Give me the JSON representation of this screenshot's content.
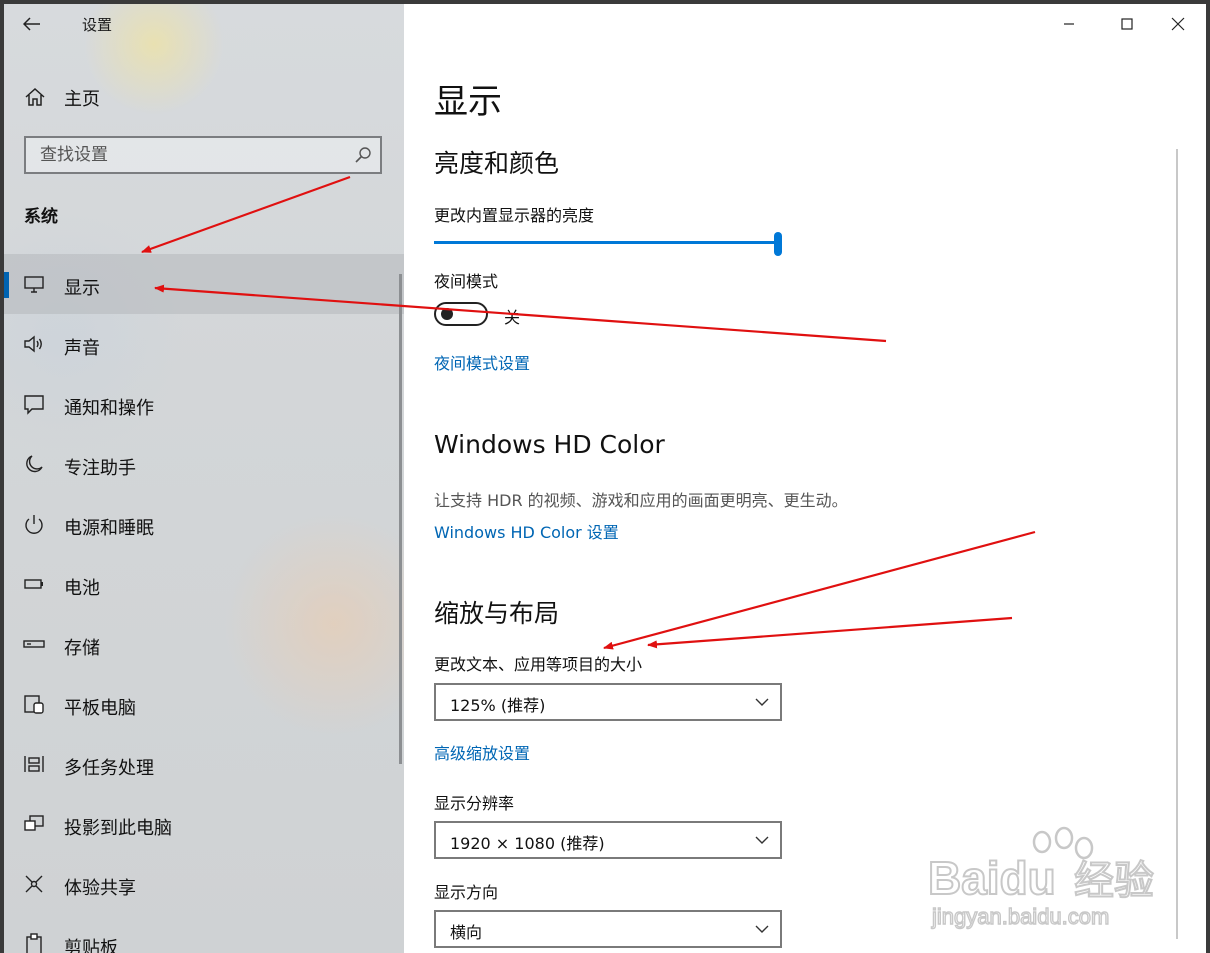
{
  "window": {
    "title": "设置"
  },
  "home": {
    "label": "主页"
  },
  "search": {
    "placeholder": "查找设置"
  },
  "sidebar": {
    "section_heading": "系统",
    "items": [
      {
        "label": "显示",
        "icon": "monitor-icon",
        "selected": true
      },
      {
        "label": "声音",
        "icon": "speaker-icon"
      },
      {
        "label": "通知和操作",
        "icon": "notification-icon"
      },
      {
        "label": "专注助手",
        "icon": "moon-icon"
      },
      {
        "label": "电源和睡眠",
        "icon": "power-icon"
      },
      {
        "label": "电池",
        "icon": "battery-icon"
      },
      {
        "label": "存储",
        "icon": "storage-icon"
      },
      {
        "label": "平板电脑",
        "icon": "tablet-icon"
      },
      {
        "label": "多任务处理",
        "icon": "multitask-icon"
      },
      {
        "label": "投影到此电脑",
        "icon": "project-icon"
      },
      {
        "label": "体验共享",
        "icon": "share-icon"
      },
      {
        "label": "剪贴板",
        "icon": "clipboard-icon"
      }
    ]
  },
  "main": {
    "page_title": "显示",
    "brightness": {
      "heading": "亮度和颜色",
      "label": "更改内置显示器的亮度",
      "value": 100
    },
    "night_light": {
      "label": "夜间模式",
      "state": "关",
      "settings_link": "夜间模式设置"
    },
    "hd_color": {
      "heading": "Windows HD Color",
      "description": "让支持 HDR 的视频、游戏和应用的画面更明亮、更生动。",
      "settings_link": "Windows HD Color 设置"
    },
    "scale_layout": {
      "heading": "缩放与布局",
      "scale_label": "更改文本、应用等项目的大小",
      "scale_value": "125% (推荐)",
      "advanced_link": "高级缩放设置",
      "resolution_label": "显示分辨率",
      "resolution_value": "1920 × 1080 (推荐)",
      "orientation_label": "显示方向",
      "orientation_value": "横向"
    }
  },
  "watermark": {
    "brand": "Baidu",
    "brand_cn": "经验",
    "url": "jingyan.baidu.com"
  },
  "colors": {
    "accent": "#0078d7",
    "link": "#0066b4",
    "annotation_arrow": "#e01010"
  }
}
